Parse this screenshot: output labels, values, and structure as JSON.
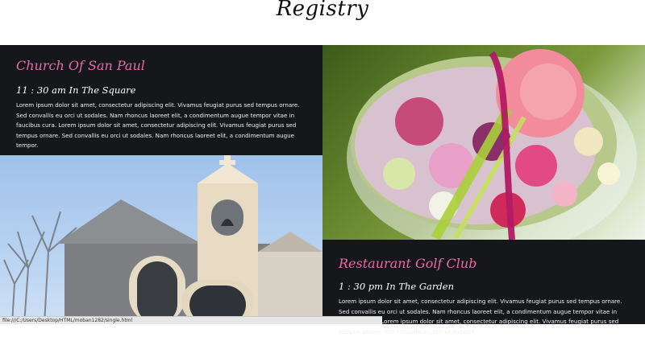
{
  "header": {
    "title": "Registry"
  },
  "events": [
    {
      "venue": "Church Of San Paul",
      "time": "11 : 30 am In The Square",
      "description": "Lorem ipsum dolor sit amet, consectetur adipiscing elit. Vivamus feugiat purus sed tempus ornare. Sed convallis eu orci ut sodales. Nam rhoncus laoreet elit, a condimentum augue tempor vitae in faucibus cura. Lorem ipsum dolor sit amet, consectetur adipiscing elit. Vivamus feugiat purus sed tempus ornare. Sed convallis eu orci ut sodales. Nam rhoncus laoreet elit, a condimentum augue tempor."
    },
    {
      "venue": "Restaurant Golf Club",
      "time": "1 : 30 pm In The Garden",
      "description": "Lorem ipsum dolor sit amet, consectetur adipiscing elit. Vivamus feugiat purus sed tempus ornare. Sed convallis eu orci ut sodales. Nam rhoncus laoreet elit, a condimentum augue tempor vitae in faucibus cura. Lorem ipsum dolor sit amet, consectetur adipiscing elit. Vivamus feugiat purus sed tempus ornare. Sed convallis eu orci ut sodales."
    }
  ],
  "status_bar": {
    "url": "file:///C:/Users/Desktop/HTML/moban1282/single.html"
  },
  "colors": {
    "accent": "#e86aa8",
    "panel": "#15171b"
  },
  "images": {
    "flowers": "flower-bouquet-image",
    "church": "church-bell-tower-image"
  }
}
